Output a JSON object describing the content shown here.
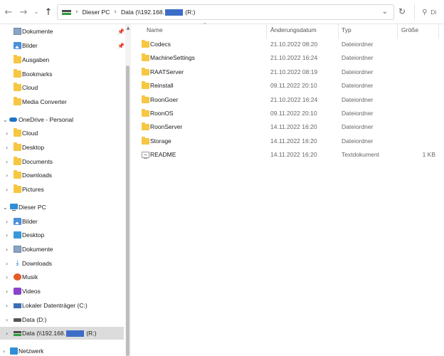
{
  "nav": {
    "back_icon": "back-arrow-icon",
    "forward_icon": "forward-arrow-icon",
    "down_icon": "chevron-down-icon",
    "up_icon": "up-arrow-icon"
  },
  "address": {
    "crumb_pc": "Dieser PC",
    "crumb_drive_prefix": "Data (\\\\192.168.",
    "crumb_drive_suffix": " (R:)",
    "redaction_color": "#3d6ec7"
  },
  "search": {
    "placeholder": "Di"
  },
  "sidebar": {
    "quick_access": [
      {
        "label": "Dokumente",
        "icon": "documents-icon",
        "pinned": true
      },
      {
        "label": "Bilder",
        "icon": "pictures-icon",
        "pinned": true
      },
      {
        "label": "Ausgaben",
        "icon": "folder-icon"
      },
      {
        "label": "Bookmarks",
        "icon": "folder-icon"
      },
      {
        "label": "Cloud",
        "icon": "folder-icon"
      },
      {
        "label": "Media Converter",
        "icon": "folder-icon"
      }
    ],
    "onedrive": {
      "label": "OneDrive - Personal",
      "children": [
        "Cloud",
        "Desktop",
        "Documents",
        "Downloads",
        "Pictures"
      ]
    },
    "this_pc": {
      "label": "Dieser PC",
      "children": [
        {
          "label": "Bilder",
          "icon": "pictures-icon"
        },
        {
          "label": "Desktop",
          "icon": "desktop-icon"
        },
        {
          "label": "Dokumente",
          "icon": "documents-icon"
        },
        {
          "label": "Downloads",
          "icon": "downloads-icon"
        },
        {
          "label": "Musik",
          "icon": "music-icon"
        },
        {
          "label": "Videos",
          "icon": "videos-icon"
        },
        {
          "label": "Lokaler Datenträger (C:)",
          "icon": "local-disk-icon"
        },
        {
          "label": "Data (D:)",
          "icon": "disk-icon"
        }
      ],
      "selected_drive": {
        "prefix": "Data (\\\\192.168.",
        "suffix": " (R:)"
      }
    },
    "network": {
      "label": "Netzwerk"
    }
  },
  "columns": {
    "name": "Name",
    "date": "Änderungsdatum",
    "type": "Typ",
    "size": "Größe"
  },
  "files": [
    {
      "name": "Codecs",
      "date": "21.10.2022 08:20",
      "type": "Dateiordner",
      "size": "",
      "icon": "folder"
    },
    {
      "name": "MachineSettings",
      "date": "21.10.2022 16:24",
      "type": "Dateiordner",
      "size": "",
      "icon": "folder"
    },
    {
      "name": "RAATServer",
      "date": "21.10.2022 08:19",
      "type": "Dateiordner",
      "size": "",
      "icon": "folder"
    },
    {
      "name": "Reinstall",
      "date": "09.11.2022 20:10",
      "type": "Dateiordner",
      "size": "",
      "icon": "folder"
    },
    {
      "name": "RoonGoer",
      "date": "21.10.2022 16:24",
      "type": "Dateiordner",
      "size": "",
      "icon": "folder"
    },
    {
      "name": "RoonOS",
      "date": "09.11.2022 20:10",
      "type": "Dateiordner",
      "size": "",
      "icon": "folder"
    },
    {
      "name": "RoonServer",
      "date": "14.11.2022 16:20",
      "type": "Dateiordner",
      "size": "",
      "icon": "folder"
    },
    {
      "name": "Storage",
      "date": "14.11.2022 16:20",
      "type": "Dateiordner",
      "size": "",
      "icon": "folder"
    },
    {
      "name": "README",
      "date": "14.11.2022 16:20",
      "type": "Textdokument",
      "size": "1 KB",
      "icon": "text-file"
    }
  ]
}
